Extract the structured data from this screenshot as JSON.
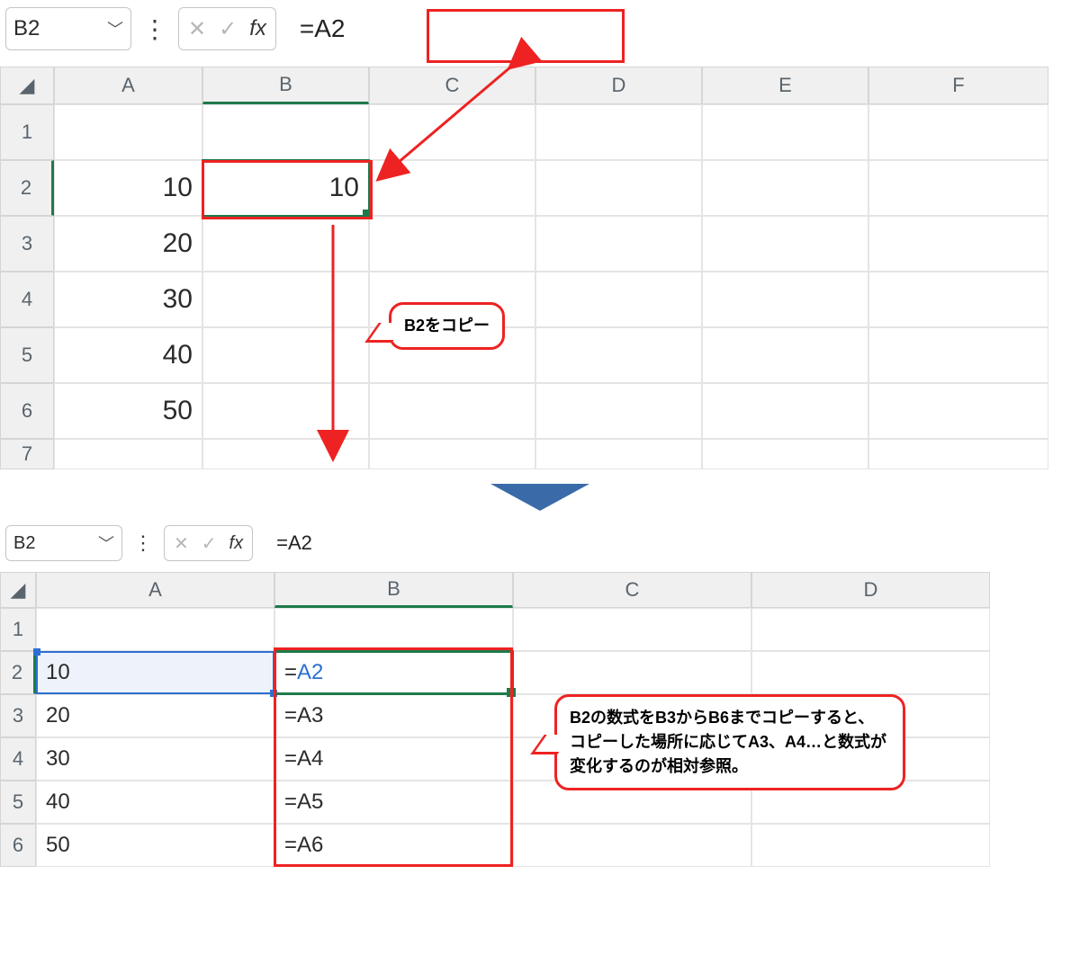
{
  "top": {
    "namebox": "B2",
    "formula": "=A2",
    "columns": [
      "A",
      "B",
      "C",
      "D",
      "E",
      "F"
    ],
    "rows": [
      "1",
      "2",
      "3",
      "4",
      "5",
      "6",
      "7"
    ],
    "A": {
      "2": "10",
      "3": "20",
      "4": "30",
      "5": "40",
      "6": "50"
    },
    "B": {
      "2": "10"
    },
    "callout": "B2をコピー"
  },
  "bottom": {
    "namebox": "B2",
    "formula": "=A2",
    "columns": [
      "A",
      "B",
      "C",
      "D"
    ],
    "rows": [
      "1",
      "2",
      "3",
      "4",
      "5",
      "6"
    ],
    "A": {
      "2": "10",
      "3": "20",
      "4": "30",
      "5": "40",
      "6": "50"
    },
    "B_prefix": "=",
    "B": {
      "2": "A2",
      "3": "A3",
      "4": "A4",
      "5": "A5",
      "6": "A6"
    },
    "callout_lines": [
      "B2の数式をB3からB6までコピーすると、",
      "コピーした場所に応じてA3、A4…と数式が",
      "変化するのが相対参照。"
    ]
  },
  "colors": {
    "accent_red": "#e22",
    "excel_green": "#1f7a4b",
    "ref_blue": "#2c6fd1"
  }
}
